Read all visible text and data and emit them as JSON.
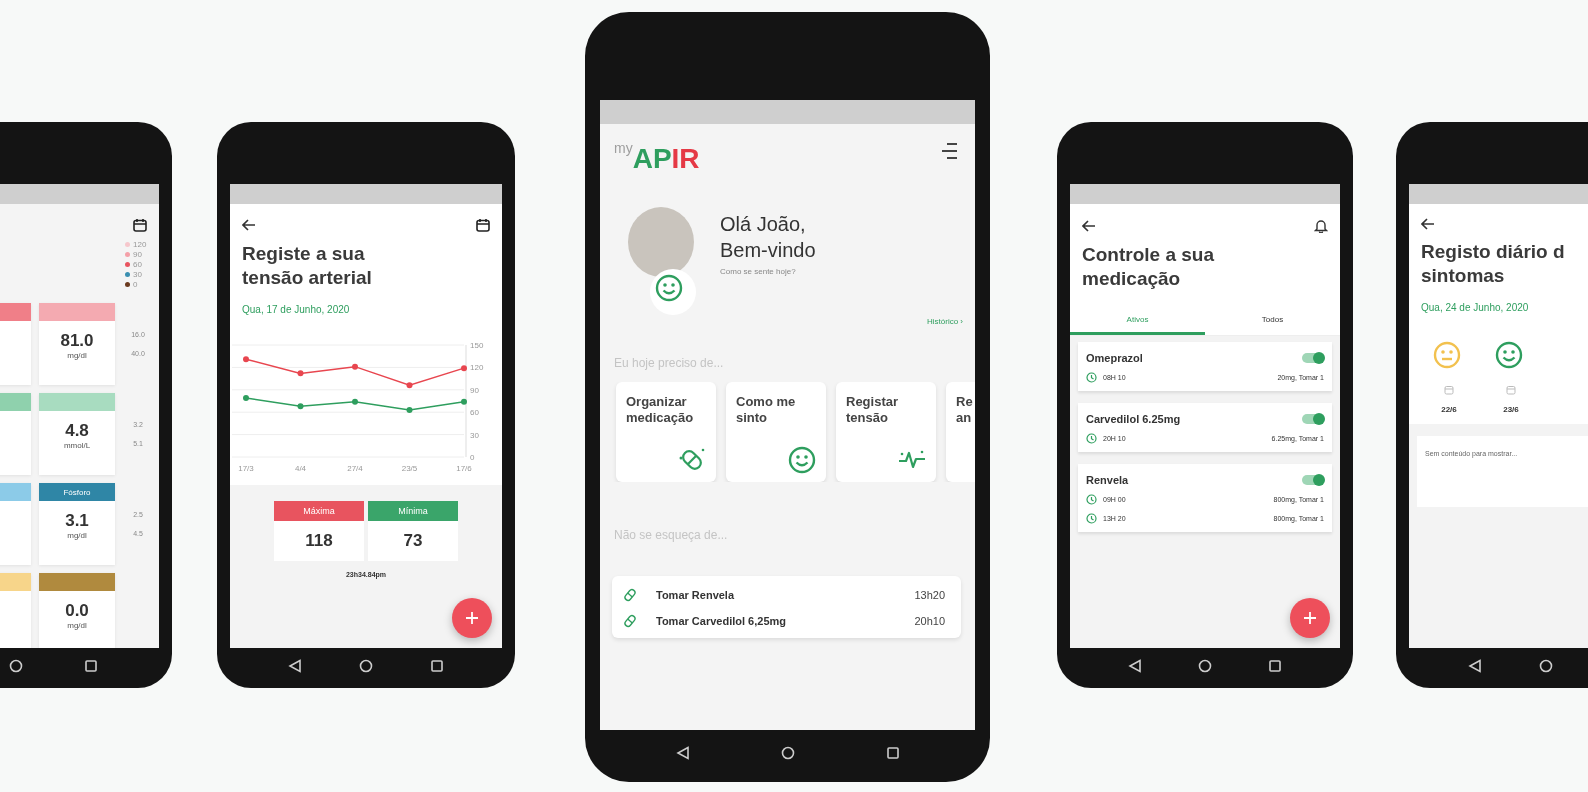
{
  "phones": [
    {
      "kind": "lab_results",
      "legend": [
        {
          "label": "120",
          "color": "#f6c7cc"
        },
        {
          "label": "90",
          "color": "#f4a0a8"
        },
        {
          "label": "60",
          "color": "#e8545f"
        },
        {
          "label": "30",
          "color": "#3a8fb0"
        },
        {
          "label": "0",
          "color": "#6b3a1f"
        }
      ],
      "rows": [
        {
          "cards": [
            {
              "color": "#f07f88"
            },
            {
              "color": "#f4aab1",
              "value": "81.0",
              "unit": "mg/dl"
            }
          ],
          "range": [
            "16.0",
            "40.0"
          ]
        },
        {
          "cards": [
            {
              "color": "#8fd1ad"
            },
            {
              "color": "#a8dcc0",
              "value": "4.8",
              "unit": "mmol/L"
            }
          ],
          "range": [
            "3.2",
            "5.1"
          ]
        },
        {
          "cards": [
            {
              "color": "#8ccbe8"
            },
            {
              "color": "#2f86a6",
              "label": "Fósforo",
              "value": "3.1",
              "unit": "mg/dl"
            }
          ],
          "range": [
            "2.5",
            "4.5"
          ]
        },
        {
          "cards": [
            {
              "color": "#f7d58a"
            },
            {
              "color": "#b08a3e",
              "value": "0.0",
              "unit": "mg/dl"
            }
          ]
        }
      ]
    },
    {
      "kind": "blood_pressure",
      "title": [
        "Registe a sua",
        "tensão arterial"
      ],
      "date": "Qua, 17 de Junho, 2020",
      "chart_data": {
        "type": "line",
        "categories": [
          "17/3",
          "4/4",
          "27/4",
          "23/5",
          "17/6"
        ],
        "series": [
          {
            "color": "#e8464f",
            "marker": true,
            "values": [
              131,
              112,
              121,
              96,
              119
            ]
          },
          {
            "color": "#2e9e5e",
            "marker": true,
            "values": [
              79,
              68,
              74,
              63,
              74
            ]
          }
        ],
        "ylim": [
          0,
          150
        ],
        "yticks": [
          0,
          30,
          60,
          90,
          120,
          150
        ],
        "grid": true
      },
      "readings": [
        {
          "label": "Máxima",
          "value": "118",
          "color": "#e8545f"
        },
        {
          "label": "Mínima",
          "value": "73",
          "color": "#3aa56a"
        }
      ],
      "time": "23h34.84pm"
    },
    {
      "kind": "home",
      "logo": [
        {
          "text": "my",
          "color": "#9e9e9e"
        },
        {
          "text": "AP",
          "color": "#2e9e5e"
        },
        {
          "text": "IR",
          "color": "#e53945"
        }
      ],
      "greeting": [
        "Olá João,",
        "Bem-vindo"
      ],
      "subtitle": "Como se sente hoje?",
      "history_link": "Histórico ›",
      "needs_heading": "Eu hoje preciso de...",
      "actions": [
        {
          "lines": [
            "Organizar",
            "medicação"
          ],
          "kind": "pill"
        },
        {
          "lines": [
            "Como me",
            "sinto"
          ],
          "kind": "smile"
        },
        {
          "lines": [
            "Registar",
            "tensão"
          ],
          "kind": "pulse"
        },
        {
          "lines": [
            "Re",
            "an"
          ],
          "kind": "cut"
        }
      ],
      "reminders_heading": "Não se esqueça de...",
      "reminders": [
        {
          "text": "Tomar Renvela",
          "time": "13h20"
        },
        {
          "text": "Tomar Carvedilol 6,25mg",
          "time": "20h10"
        }
      ]
    },
    {
      "kind": "medication",
      "title": [
        "Controle a sua",
        "medicação"
      ],
      "tabs": [
        {
          "label": "Ativos",
          "selected": true
        },
        {
          "label": "Todos",
          "selected": false
        }
      ],
      "meds": [
        {
          "name": "Omeprazol",
          "on": true,
          "doses": [
            {
              "time": "08H 10",
              "dose": "20mg, Tomar 1"
            }
          ]
        },
        {
          "name": "Carvedilol 6.25mg",
          "on": true,
          "doses": [
            {
              "time": "20H 10",
              "dose": "6.25mg, Tomar 1"
            }
          ]
        },
        {
          "name": "Renvela",
          "on": true,
          "doses": [
            {
              "time": "09H 00",
              "dose": "800mg, Tomar 1"
            },
            {
              "time": "13H 20",
              "dose": "800mg, Tomar 1"
            }
          ]
        }
      ]
    },
    {
      "kind": "symptoms",
      "title": [
        "Registo diário d",
        "sintomas"
      ],
      "date": "Qua, 24 de Junho, 2020",
      "days": [
        {
          "kind": "neutral",
          "color": "#f2c14e",
          "date": "22/6"
        },
        {
          "kind": "happy",
          "color": "#2e9e5e",
          "date": "23/6"
        }
      ],
      "note": "Sem conteúdo para mostrar..."
    }
  ]
}
